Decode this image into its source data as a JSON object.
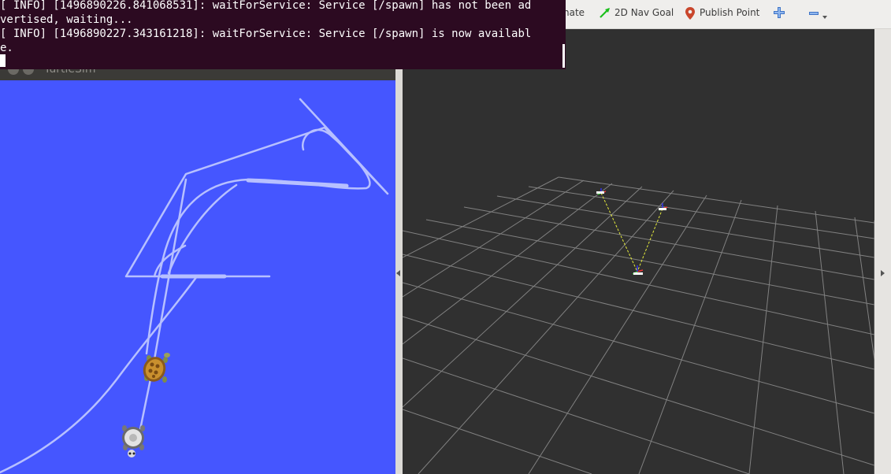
{
  "terminal": {
    "lines": [
      "[ INFO] [1496890226.841068531]: waitForService: Service [/spawn] has not been ad",
      "vertised, waiting...",
      "[ INFO] [1496890227.343161218]: waitForService: Service [/spawn] is now availabl",
      "e."
    ]
  },
  "rviz_toolbar": {
    "items": [
      {
        "label": "nate",
        "icon": "pose-estimate-icon"
      },
      {
        "label": "2D Nav Goal",
        "icon": "nav-goal-arrow-icon"
      },
      {
        "label": "Publish Point",
        "icon": "map-pin-icon"
      },
      {
        "label": "",
        "icon": "plus-move-icon"
      },
      {
        "label": "",
        "icon": "minus-dropdown-icon"
      }
    ]
  },
  "turtlesim": {
    "window_title": "TurtleSim",
    "background_color": "#4556ff",
    "trail_color": "#b7c0ff"
  },
  "rviz_view": {
    "background_color": "#303030",
    "grid_color": "#8a8a8a",
    "tf_link_color": "#e6ec3c"
  }
}
